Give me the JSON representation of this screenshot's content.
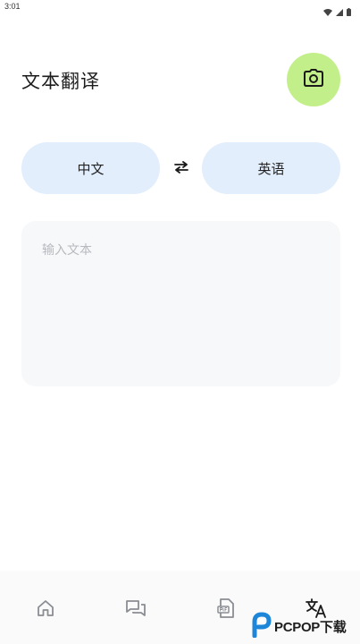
{
  "status_bar": {
    "time": "3:01",
    "icons": [
      "wifi-icon",
      "signal-icon",
      "battery-icon"
    ]
  },
  "header": {
    "title": "文本翻译",
    "camera_icon": "camera-icon",
    "accent_color": "#c3ef8a"
  },
  "languages": {
    "source": "中文",
    "target": "英语",
    "swap_icon": "swap-arrows-icon",
    "button_color": "#e3eefc"
  },
  "input": {
    "value": "",
    "placeholder": "输入文本"
  },
  "bottom_nav": {
    "items": [
      {
        "icon": "home-icon",
        "active": false
      },
      {
        "icon": "chat-icon",
        "active": false
      },
      {
        "icon": "document-icon",
        "active": false
      },
      {
        "icon": "translate-icon",
        "active": true
      }
    ]
  },
  "watermark": {
    "text": "PCPOP下载"
  }
}
